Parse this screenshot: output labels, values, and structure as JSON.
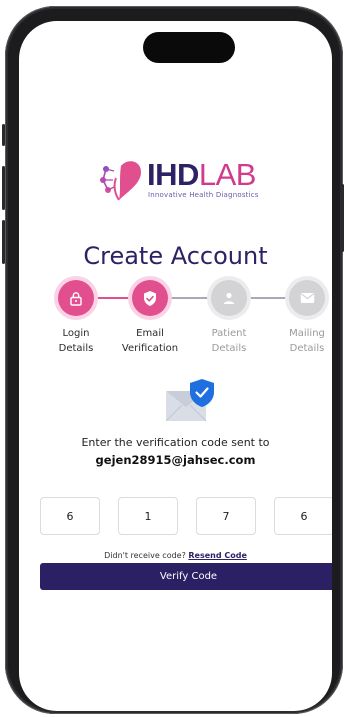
{
  "brand": {
    "name_bold": "IHD",
    "name_light": "LAB",
    "tagline": "Innovative Health Diagnostics",
    "primary_color": "#2d2266",
    "accent_color": "#e24f8f"
  },
  "page": {
    "title": "Create Account"
  },
  "stepper": {
    "steps": [
      {
        "label": "Login\nDetails",
        "icon": "lock-icon",
        "state": "complete"
      },
      {
        "label": "Email\nVerification",
        "icon": "shield-check-icon",
        "state": "active"
      },
      {
        "label": "Patient\nDetails",
        "icon": "user-icon",
        "state": "pending"
      },
      {
        "label": "Mailing\nDetails",
        "icon": "mail-icon",
        "state": "pending"
      }
    ]
  },
  "verification": {
    "instruction": "Enter the verification code sent to",
    "email": "gejen28915@jahsec.com",
    "code_digits": [
      "6",
      "1",
      "7",
      "6"
    ],
    "resend_prompt": "Didn't receive code?",
    "resend_link": "Resend Code",
    "submit_label": "Verify Code"
  }
}
